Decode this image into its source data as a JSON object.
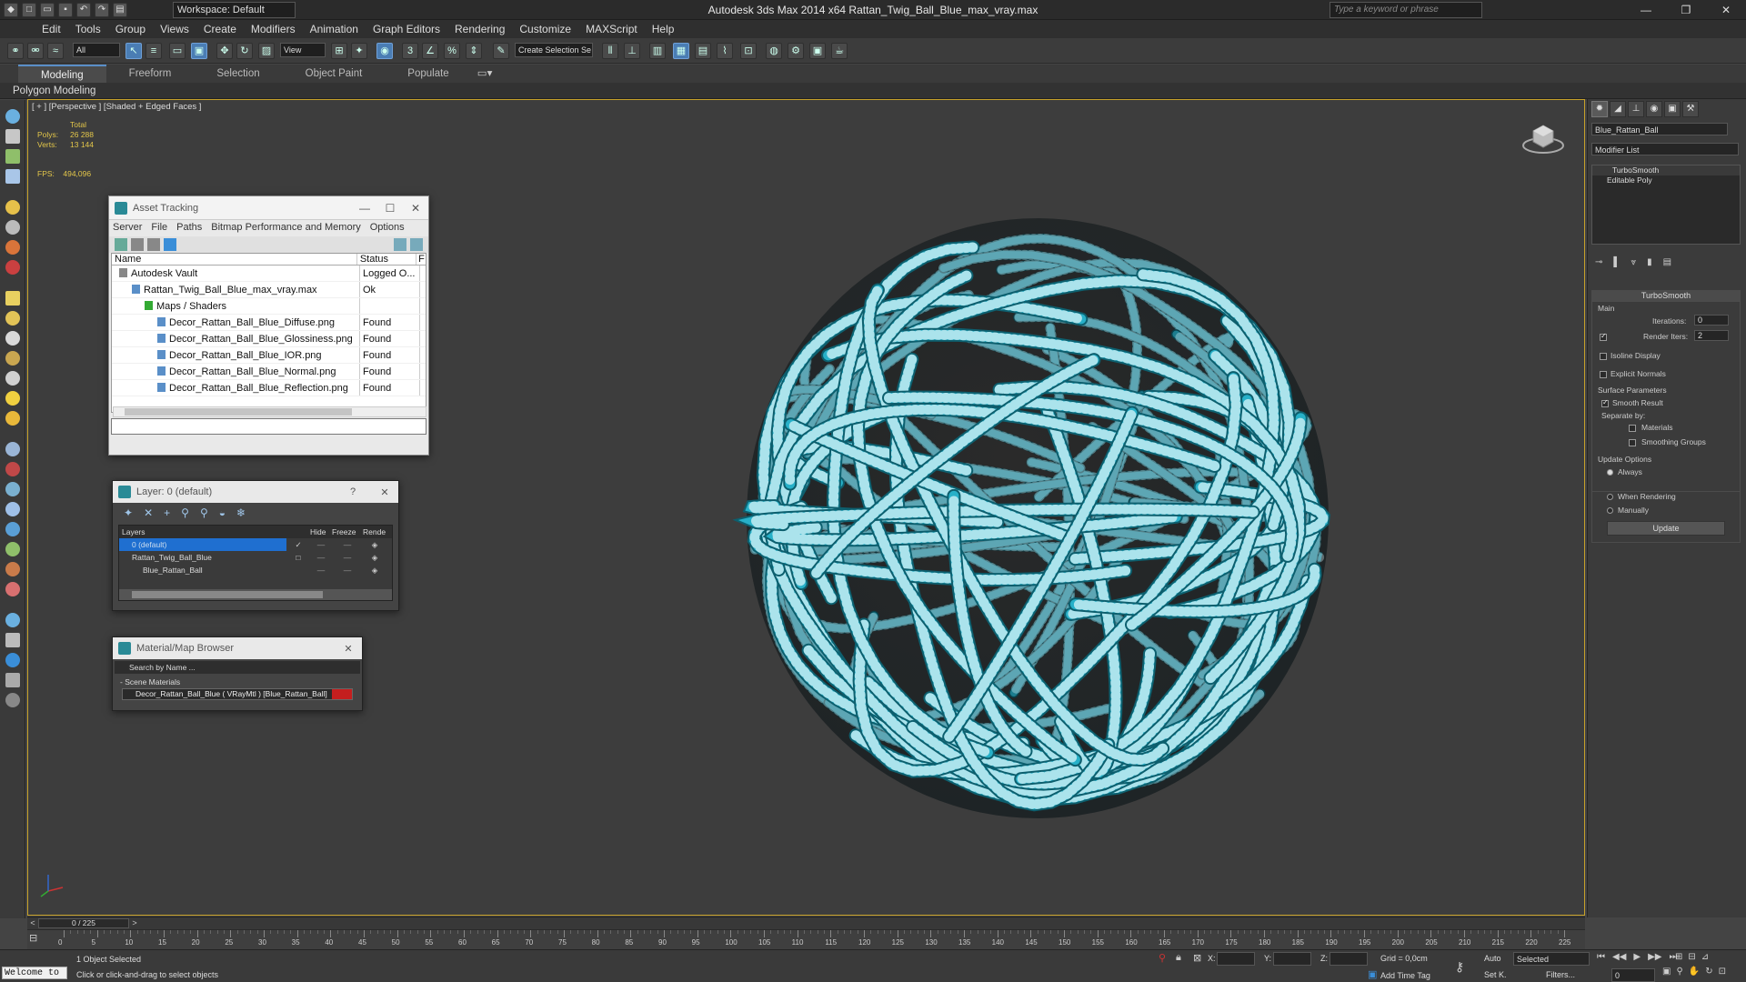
{
  "title_bar": {
    "workspace": "Workspace: Default",
    "app_title": "Autodesk 3ds Max  2014 x64      Rattan_Twig_Ball_Blue_max_vray.max",
    "search_placeholder": "Type a keyword or phrase"
  },
  "menu": [
    "Edit",
    "Tools",
    "Group",
    "Views",
    "Create",
    "Modifiers",
    "Animation",
    "Graph Editors",
    "Rendering",
    "Customize",
    "MAXScript",
    "Help"
  ],
  "toolbar": {
    "filter_select": "All",
    "view_select": "View",
    "named_selection": "Create Selection Se"
  },
  "ribbon": {
    "tabs": [
      "Modeling",
      "Freeform",
      "Selection",
      "Object Paint",
      "Populate"
    ],
    "active_tab": "Modeling",
    "sub_label": "Polygon Modeling"
  },
  "viewport": {
    "label": "[ + ] [Perspective ] [Shaded + Edged Faces ]",
    "stats_header": "Total",
    "polys_label": "Polys:",
    "polys_value": "26 288",
    "verts_label": "Verts:",
    "verts_value": "13 144",
    "fps_label": "FPS:",
    "fps_value": "494,096"
  },
  "asset_tracking": {
    "title": "Asset Tracking",
    "menu": [
      "Server",
      "File",
      "Paths",
      "Bitmap Performance and Memory",
      "Options"
    ],
    "col_name": "Name",
    "col_status": "Status",
    "col_extra": "F",
    "rows": [
      {
        "name": "Autodesk Vault",
        "status": "Logged O...",
        "indent": 0
      },
      {
        "name": "Rattan_Twig_Ball_Blue_max_vray.max",
        "status": "Ok",
        "indent": 1
      },
      {
        "name": "Maps / Shaders",
        "status": "",
        "indent": 2
      },
      {
        "name": "Decor_Rattan_Ball_Blue_Diffuse.png",
        "status": "Found",
        "indent": 3
      },
      {
        "name": "Decor_Rattan_Ball_Blue_Glossiness.png",
        "status": "Found",
        "indent": 3
      },
      {
        "name": "Decor_Rattan_Ball_Blue_IOR.png",
        "status": "Found",
        "indent": 3
      },
      {
        "name": "Decor_Rattan_Ball_Blue_Normal.png",
        "status": "Found",
        "indent": 3
      },
      {
        "name": "Decor_Rattan_Ball_Blue_Reflection.png",
        "status": "Found",
        "indent": 3
      }
    ]
  },
  "layer_dialog": {
    "title": "Layer: 0 (default)",
    "col_layers": "Layers",
    "col_hide": "Hide",
    "col_freeze": "Freeze",
    "col_render": "Rende",
    "rows": [
      {
        "name": "0 (default)",
        "selected": true
      },
      {
        "name": "Rattan_Twig_Ball_Blue",
        "selected": false
      },
      {
        "name": "Blue_Rattan_Ball",
        "selected": false
      }
    ]
  },
  "material_browser": {
    "title": "Material/Map Browser",
    "search_placeholder": "Search by Name ...",
    "group": "- Scene Materials",
    "item": "Decor_Rattan_Ball_Blue  ( VRayMtl )  [Blue_Rattan_Ball]"
  },
  "command_panel": {
    "object_name": "Blue_Rattan_Ball",
    "modifier_list": "Modifier List",
    "stack": [
      "TurboSmooth",
      "Editable Poly"
    ],
    "rollout_title": "TurboSmooth",
    "main_label": "Main",
    "iterations_label": "Iterations:",
    "iterations_value": "0",
    "render_iters_label": "Render Iters:",
    "render_iters_value": "2",
    "isoline_label": "Isoline Display",
    "explicit_normals_label": "Explicit Normals",
    "surface_params_label": "Surface Parameters",
    "smooth_result_label": "Smooth Result",
    "separate_by_label": "Separate by:",
    "materials_label": "Materials",
    "smoothing_groups_label": "Smoothing Groups",
    "update_options_label": "Update Options",
    "always_label": "Always",
    "when_rendering_label": "When Rendering",
    "manually_label": "Manually",
    "update_button": "Update"
  },
  "timeline": {
    "frame": "0 / 225",
    "ticks": [
      "0",
      "5",
      "10",
      "15",
      "20",
      "25",
      "30",
      "35",
      "40",
      "45",
      "50",
      "55",
      "60",
      "65",
      "70",
      "75",
      "80",
      "85",
      "90",
      "95",
      "100",
      "105",
      "110",
      "115",
      "120",
      "125",
      "130",
      "135",
      "140",
      "145",
      "150",
      "155",
      "160",
      "165",
      "170",
      "175",
      "180",
      "185",
      "190",
      "195",
      "200",
      "205",
      "210",
      "215",
      "220",
      "225"
    ]
  },
  "status": {
    "maxscript": "Welcome to",
    "selected": "1 Object Selected",
    "prompt": "Click or click-and-drag to select objects",
    "x_label": "X:",
    "y_label": "Y:",
    "z_label": "Z:",
    "grid": "Grid = 0,0cm",
    "add_time_tag": "Add Time Tag",
    "auto": "Auto",
    "set_k": "Set K.",
    "key_select": "Selected",
    "filters": "Filters...",
    "frame_field": "0"
  },
  "colors": {
    "wire": "#27b0c8",
    "viewport_border": "#c8a22a",
    "stats": "#e3c64a",
    "selection": "#1f6fd0"
  }
}
